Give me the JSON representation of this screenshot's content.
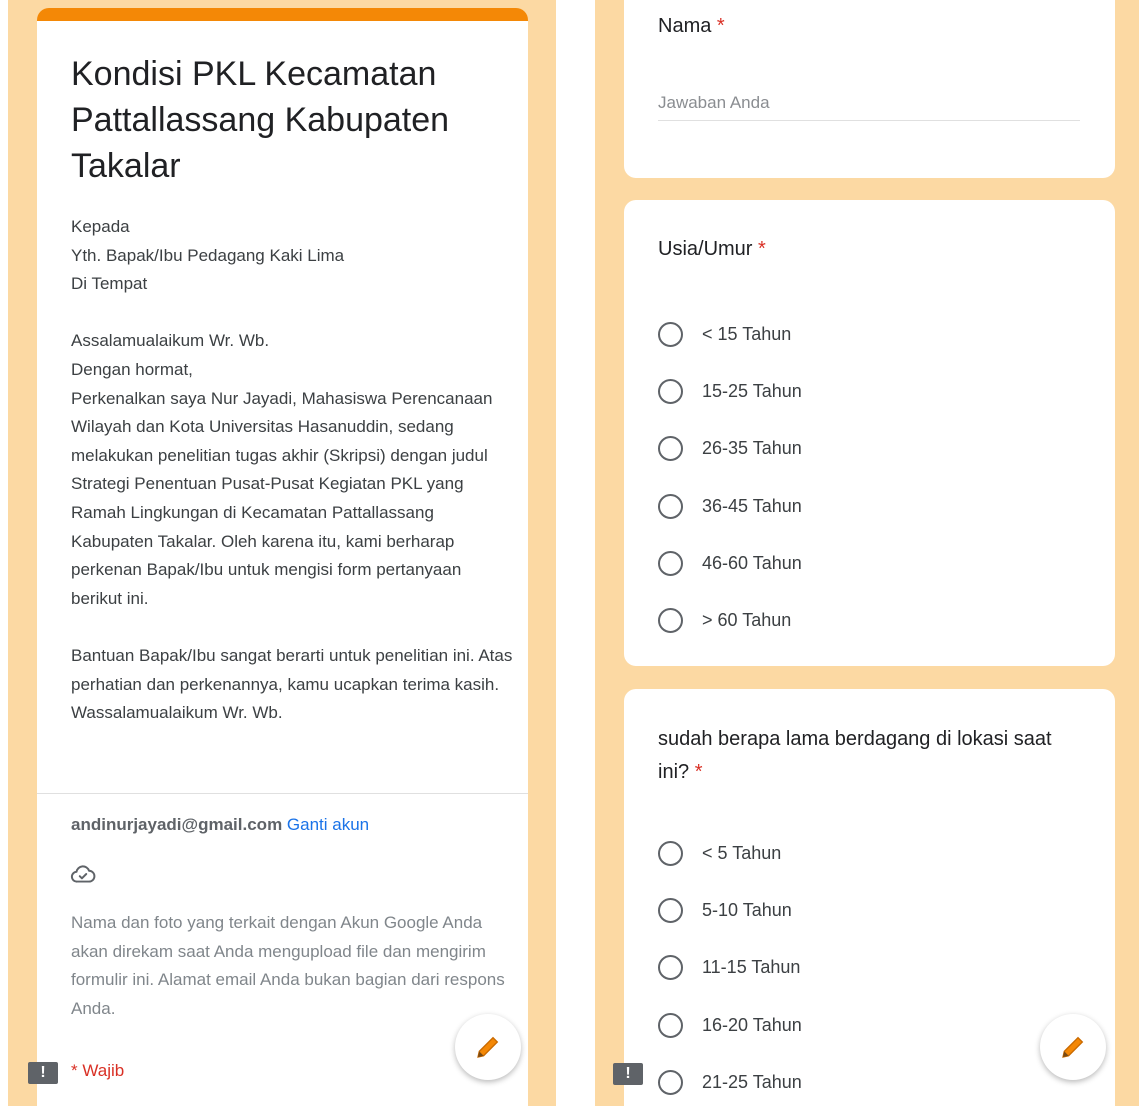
{
  "left_screen": {
    "form_title": "Kondisi PKL Kecamatan Pattallassang Kabupaten Takalar",
    "description": "Kepada\nYth. Bapak/Ibu Pedagang Kaki Lima\nDi Tempat\n\nAssalamualaikum Wr. Wb.\nDengan hormat,\nPerkenalkan saya Nur Jayadi, Mahasiswa Perencanaan Wilayah dan Kota Universitas Hasanuddin, sedang melakukan penelitian tugas akhir (Skripsi) dengan judul Strategi Penentuan Pusat-Pusat Kegiatan PKL yang Ramah Lingkungan di Kecamatan Pattallassang Kabupaten Takalar. Oleh karena itu, kami berharap perkenan Bapak/Ibu untuk mengisi form pertanyaan berikut ini.\n\nBantuan Bapak/Ibu sangat berarti untuk penelitian ini. Atas perhatian dan perkenannya, kamu ucapkan terima kasih.\nWassalamualaikum Wr. Wb.",
    "account_email": "andinurjayadi@gmail.com",
    "switch_account": "Ganti akun",
    "cloud_icon": "cloud-check-icon",
    "privacy_note": "Nama dan foto yang terkait dengan Akun Google Anda akan direkam saat Anda mengupload file dan mengirim formulir ini. Alamat email Anda bukan bagian dari respons Anda.",
    "required_note": "* Wajib"
  },
  "right_screen": {
    "name_question": {
      "label": "Nama",
      "required_mark": "*",
      "placeholder": "Jawaban Anda"
    },
    "age_question": {
      "label": "Usia/Umur",
      "required_mark": "*",
      "options": [
        "< 15 Tahun",
        "15-25 Tahun",
        "26-35 Tahun",
        "36-45 Tahun",
        "46-60 Tahun",
        "> 60 Tahun"
      ]
    },
    "duration_question": {
      "label": "sudah berapa lama berdagang di lokasi saat ini?",
      "required_mark": "*",
      "options": [
        "< 5 Tahun",
        "5-10 Tahun",
        "11-15 Tahun",
        "16-20 Tahun",
        "21-25 Tahun"
      ]
    }
  },
  "feedback_icon": {
    "glyph": "!",
    "name": "feedback-icon"
  },
  "fab_icon": "pencil-icon",
  "colors": {
    "theme": "#f48806",
    "background": "#fcd9a3",
    "required": "#d93025",
    "link": "#1a73e8"
  }
}
